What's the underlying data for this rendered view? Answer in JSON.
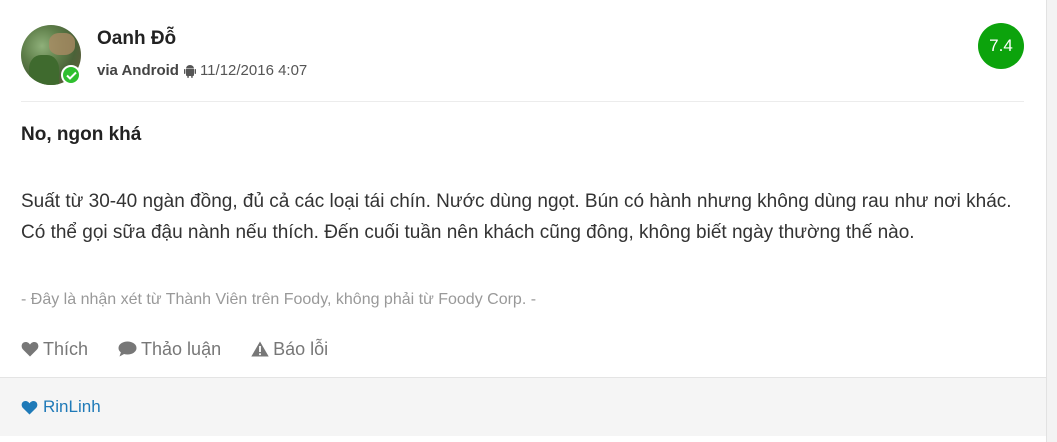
{
  "review": {
    "user_name": "Oanh Đỗ",
    "via": "via Android",
    "timestamp": "11/12/2016 4:07",
    "score": "7.4",
    "title": "No, ngon khá",
    "body": "Suất từ 30-40 ngàn đồng, đủ cả các loại tái chín. Nước dùng ngọt. Bún có hành nhưng không dùng rau như nơi khác. Có thể gọi sữa đậu nành nếu thích. Đến cuối tuần nên khách cũng đông, không biết ngày thường thế nào.",
    "disclaimer": "- Đây là nhận xét từ Thành Viên trên Foody, không phải từ Foody Corp. -"
  },
  "actions": {
    "like_label": "Thích",
    "discuss_label": "Thảo luận",
    "report_label": "Báo lỗi"
  },
  "footer": {
    "liker_name": "RinLinh"
  },
  "colors": {
    "score_bg": "#0ca30c",
    "verified_badge": "#2fbf2f",
    "liker_link": "#1f7ab8",
    "action_gray": "#777777"
  },
  "icons": {
    "verified": "check-icon",
    "platform": "android-icon",
    "like": "heart-icon",
    "discuss": "comment-icon",
    "report": "warning-icon",
    "liker": "heart-icon"
  }
}
